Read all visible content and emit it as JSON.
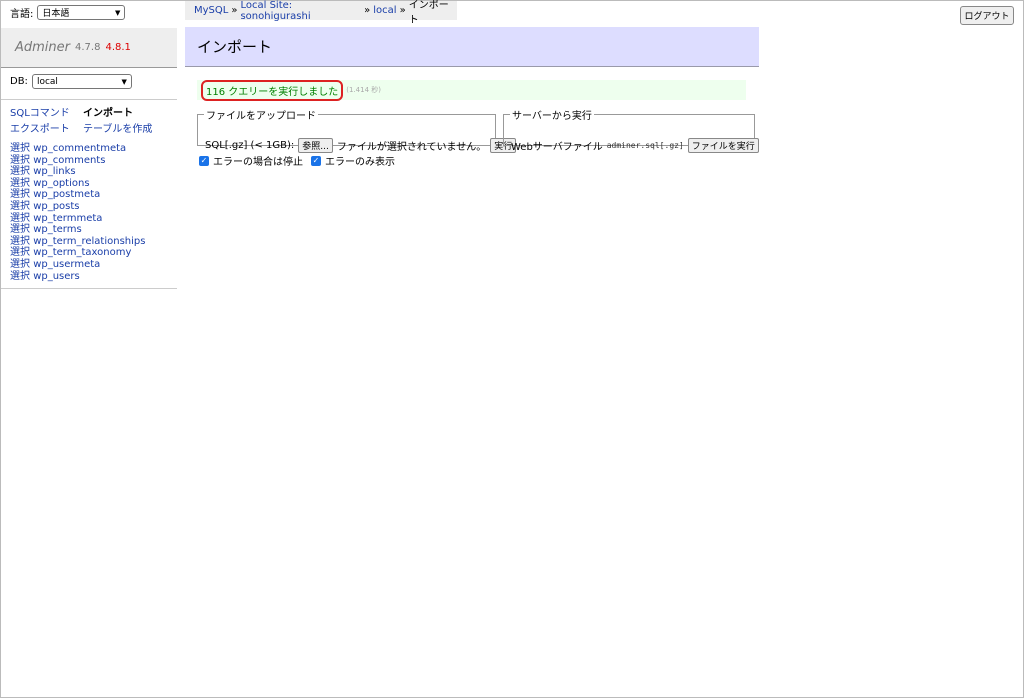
{
  "lang": {
    "label": "言語:",
    "selected": "日本語"
  },
  "breadcrumb": [
    {
      "label": "MySQL",
      "link": true
    },
    {
      "label": "»",
      "link": false
    },
    {
      "label": "Local Site: sonohigurashi",
      "link": true
    },
    {
      "label": "»",
      "link": false
    },
    {
      "label": "local",
      "link": true
    },
    {
      "label": "»",
      "link": false
    },
    {
      "label": "インポート",
      "link": false
    }
  ],
  "logout_label": "ログアウト",
  "brand": {
    "name": "Adminer",
    "version": "4.7.8",
    "new_version": "4.8.1"
  },
  "db": {
    "label": "DB:",
    "selected": "local"
  },
  "commands": {
    "sql": "SQLコマンド",
    "import": "インポート",
    "export": "エクスポート",
    "create_table": "テーブルを作成"
  },
  "tables": [
    {
      "select": "選択",
      "name": "wp_commentmeta"
    },
    {
      "select": "選択",
      "name": "wp_comments"
    },
    {
      "select": "選択",
      "name": "wp_links"
    },
    {
      "select": "選択",
      "name": "wp_options"
    },
    {
      "select": "選択",
      "name": "wp_postmeta"
    },
    {
      "select": "選択",
      "name": "wp_posts"
    },
    {
      "select": "選択",
      "name": "wp_termmeta"
    },
    {
      "select": "選択",
      "name": "wp_terms"
    },
    {
      "select": "選択",
      "name": "wp_term_relationships"
    },
    {
      "select": "選択",
      "name": "wp_term_taxonomy"
    },
    {
      "select": "選択",
      "name": "wp_usermeta"
    },
    {
      "select": "選択",
      "name": "wp_users"
    }
  ],
  "page_title": "インポート",
  "message": {
    "text": "116 クエリーを実行しました",
    "time": "(1.414 秒)"
  },
  "upload": {
    "legend": "ファイルをアップロード",
    "label": "SQL[.gz] (< 1GB):",
    "browse_button": "参照...",
    "no_file": "ファイルが選択されていません。",
    "execute_button": "実行"
  },
  "server": {
    "legend": "サーバーから実行",
    "label": "Webサーバファイル",
    "filename": "adminer.sql[.gz]",
    "execute_button": "ファイルを実行"
  },
  "options": {
    "stop_on_error": "エラーの場合は停止",
    "errors_only": "エラーのみ表示"
  }
}
